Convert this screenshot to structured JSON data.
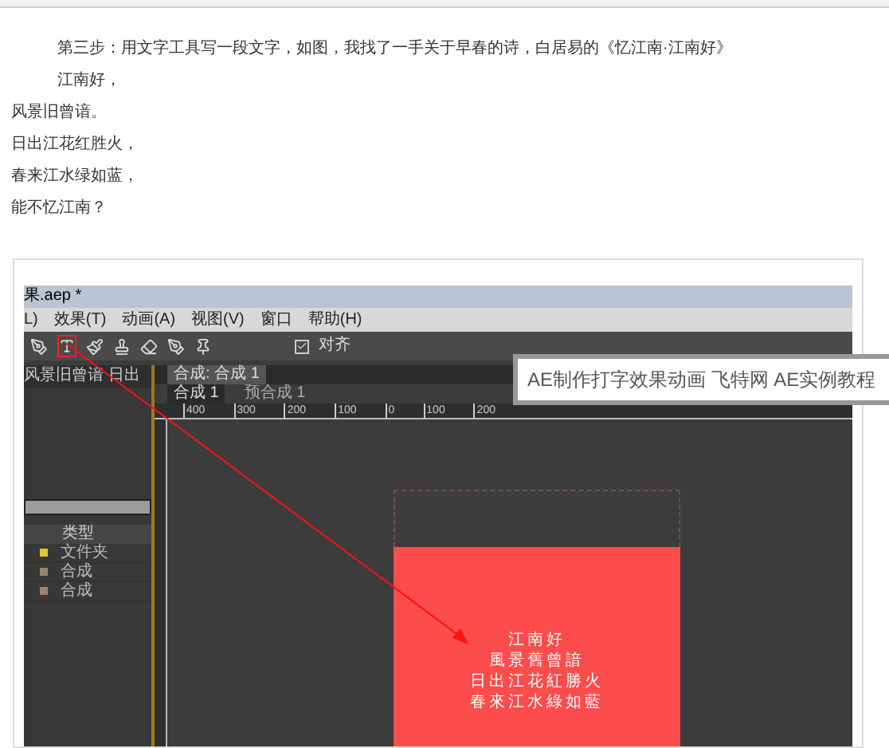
{
  "article": {
    "paragraphs": [
      {
        "kind": "indented",
        "text": "第三步：用文字工具写一段文字，如图，我找了一手关于早春的诗，白居易的《忆江南·江南好》"
      },
      {
        "kind": "indented",
        "text": "江南好，"
      },
      {
        "kind": "plain",
        "text": "风景旧曾谙。"
      },
      {
        "kind": "plain",
        "text": "日出江花红胜火，"
      },
      {
        "kind": "plain",
        "text": "春来江水绿如蓝，"
      },
      {
        "kind": "plain",
        "text": "能不忆江南？"
      }
    ]
  },
  "screenshot": {
    "title": "果.aep *",
    "menu": [
      "L)",
      "效果(T)",
      "动画(A)",
      "视图(V)",
      "窗口",
      "帮助(H)"
    ],
    "snap": {
      "label": "对齐",
      "checked": true
    },
    "project_panel": {
      "tab": "风景旧曾谙 日出",
      "column": "类型",
      "items": [
        {
          "label": "文件夹",
          "color": "#d8c83a"
        },
        {
          "label": "合成",
          "color": "#9c8468"
        },
        {
          "label": "合成",
          "color": "#9c8468"
        }
      ]
    },
    "comp_tab": "合成: 合成 1",
    "breadcrumbs": [
      {
        "label": "合成 1",
        "selected": true
      },
      {
        "label": "预合成 1",
        "selected": false
      }
    ],
    "ruler_labels": [
      "400",
      "300",
      "200",
      "100",
      "0",
      "100",
      "200"
    ],
    "poem_lines": [
      "江南好",
      "風景舊曾諳",
      "日出江花紅勝火",
      "春來江水綠如藍"
    ]
  },
  "tooltip": "AE制作打字效果动画 飞特网 AE实例教程"
}
